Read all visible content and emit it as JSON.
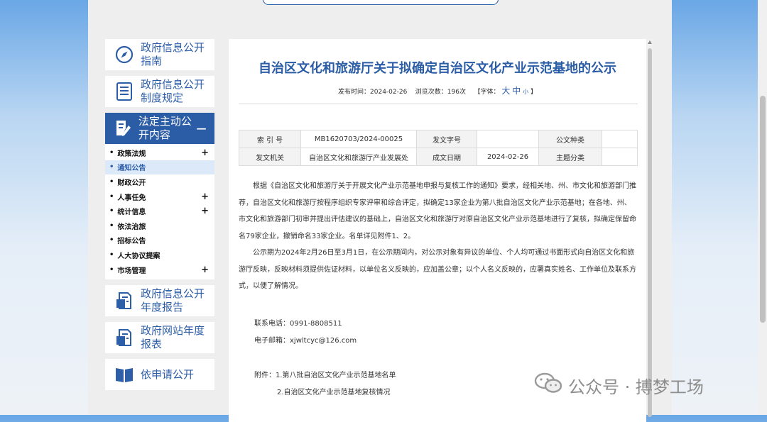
{
  "sidebar": {
    "boxes_top": [
      {
        "label": "政府信息公开指南",
        "icon": "compass-icon"
      },
      {
        "label": "政府信息公开制度规定",
        "icon": "document-list-icon"
      }
    ],
    "active": {
      "label": "法定主动公开内容",
      "icon": "edit-document-icon",
      "toggle": "−"
    },
    "sub_items": [
      {
        "label": "政策法规",
        "plus": "+"
      },
      {
        "label": "通知公告",
        "plus": ""
      },
      {
        "label": "财政公开",
        "plus": ""
      },
      {
        "label": "人事任免",
        "plus": "+"
      },
      {
        "label": "统计信息",
        "plus": "+"
      },
      {
        "label": "依法治旅",
        "plus": ""
      },
      {
        "label": "招标公告",
        "plus": ""
      },
      {
        "label": "人大协议提案",
        "plus": ""
      },
      {
        "label": "市场管理",
        "plus": "+"
      }
    ],
    "boxes_bottom": [
      {
        "label": "政府信息公开年度报告",
        "icon": "report-icon"
      },
      {
        "label": "政府网站年度报表",
        "icon": "report-icon"
      },
      {
        "label": "依申请公开",
        "icon": "book-icon"
      }
    ]
  },
  "article": {
    "title": "自治区文化和旅游厅关于拟确定自治区文化产业示范基地的公示",
    "publish_label": "发布时间：",
    "publish_date": "2024-02-26",
    "views_label": "浏览次数：",
    "views": "196次",
    "font_label_open": "【字体：",
    "font_large": "大",
    "font_medium": "中",
    "font_small": "小",
    "font_label_close": "】"
  },
  "info_table": {
    "row1": [
      "索 引 号",
      "MB1620703/2024-00025",
      "发文字号",
      "",
      "公文种类",
      ""
    ],
    "row2": [
      "发文机关",
      "自治区文化和旅游厅产业发展处",
      "成文日期",
      "2024-02-26",
      "主题分类",
      ""
    ]
  },
  "body": {
    "p1": "根据《自治区文化和旅游厅关于开展文化产业示范基地申报与复核工作的通知》要求，经相关地、州、市文化和旅游部门推荐，自治区文化和旅游厅按程序组织专家评审和综合评定，拟确定13家企业为第八批自治区文化产业示范基地；在各地、州、市文化和旅游部门初审并提出评估建议的基础上，自治区文化和旅游厅对原自治区文化产业示范基地进行了复核，拟确定保留命名79家企业，撤销命名33家企业。名单详见附件1、2。",
    "p2": "公示期为2024年2月26日至3月1日，在公示期间内，对公示对象有异议的单位、个人均可通过书面形式向自治区文化和旅游厅反映，反映材料须提供佐证材料，以单位名义反映的，应加盖公章；以个人名义反映的，应署真实姓名、工作单位及联系方式，以便了解情况。",
    "phone": "联系电话：0991-8808511",
    "email": "电子邮箱：xjwltcyc@126.com",
    "attach1": "附件：1.第八批自治区文化产业示范基地名单",
    "attach2": "2.自治区文化产业示范基地复核情况"
  },
  "watermark": {
    "text": "公众号 · 搏梦工场",
    "icon": "wechat-icon"
  }
}
